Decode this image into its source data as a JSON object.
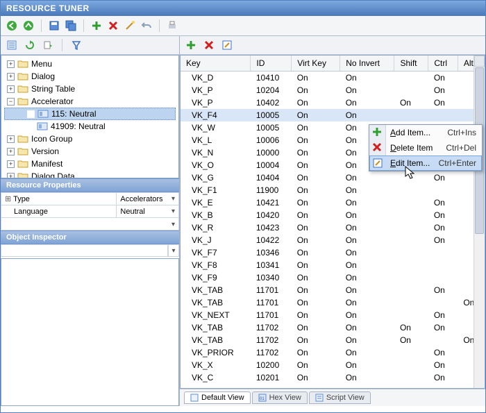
{
  "app": {
    "title": "RESOURCE TUNER"
  },
  "tree": {
    "items": [
      {
        "label": "Menu",
        "expander": "+",
        "depth": 1
      },
      {
        "label": "Dialog",
        "expander": "+",
        "depth": 1
      },
      {
        "label": "String Table",
        "expander": "+",
        "depth": 1
      },
      {
        "label": "Accelerator",
        "expander": "−",
        "depth": 1
      },
      {
        "label": "115: Neutral",
        "expander": "",
        "depth": 2,
        "icon": "accel",
        "sel": true
      },
      {
        "label": "41909: Neutral",
        "expander": "",
        "depth": 2,
        "icon": "accel"
      },
      {
        "label": "Icon Group",
        "expander": "+",
        "depth": 1
      },
      {
        "label": "Version",
        "expander": "+",
        "depth": 1
      },
      {
        "label": "Manifest",
        "expander": "+",
        "depth": 1
      },
      {
        "label": "Dialog Data",
        "expander": "+",
        "depth": 1
      }
    ]
  },
  "panels": {
    "resprops": {
      "title": "Resource Properties",
      "rows": [
        {
          "name": "Type",
          "value": "Accelerators"
        },
        {
          "name": "Language",
          "value": "Neutral"
        }
      ]
    },
    "inspector": {
      "title": "Object Inspector"
    }
  },
  "grid": {
    "columns": [
      "Key",
      "ID",
      "Virt Key",
      "No Invert",
      "Shift",
      "Ctrl",
      "Alt"
    ],
    "rows": [
      {
        "key": "VK_D",
        "id": "10410",
        "virt": "On",
        "noinv": "On",
        "shift": "",
        "ctrl": "On",
        "alt": ""
      },
      {
        "key": "VK_P",
        "id": "10204",
        "virt": "On",
        "noinv": "On",
        "shift": "",
        "ctrl": "On",
        "alt": ""
      },
      {
        "key": "VK_P",
        "id": "10402",
        "virt": "On",
        "noinv": "On",
        "shift": "On",
        "ctrl": "On",
        "alt": ""
      },
      {
        "key": "VK_F4",
        "id": "10005",
        "virt": "On",
        "noinv": "On",
        "shift": "",
        "ctrl": "",
        "alt": "",
        "sel": true
      },
      {
        "key": "VK_W",
        "id": "10005",
        "virt": "On",
        "noinv": "On",
        "shift": "",
        "ctrl": "On",
        "alt": ""
      },
      {
        "key": "VK_L",
        "id": "10006",
        "virt": "On",
        "noinv": "On",
        "shift": "",
        "ctrl": "On",
        "alt": ""
      },
      {
        "key": "VK_N",
        "id": "10000",
        "virt": "On",
        "noinv": "On",
        "shift": "",
        "ctrl": "On",
        "alt": ""
      },
      {
        "key": "VK_O",
        "id": "10004",
        "virt": "On",
        "noinv": "On",
        "shift": "",
        "ctrl": "On",
        "alt": ""
      },
      {
        "key": "VK_G",
        "id": "10404",
        "virt": "On",
        "noinv": "On",
        "shift": "",
        "ctrl": "On",
        "alt": ""
      },
      {
        "key": "VK_F1",
        "id": "11900",
        "virt": "On",
        "noinv": "On",
        "shift": "",
        "ctrl": "",
        "alt": ""
      },
      {
        "key": "VK_E",
        "id": "10421",
        "virt": "On",
        "noinv": "On",
        "shift": "",
        "ctrl": "On",
        "alt": ""
      },
      {
        "key": "VK_B",
        "id": "10420",
        "virt": "On",
        "noinv": "On",
        "shift": "",
        "ctrl": "On",
        "alt": ""
      },
      {
        "key": "VK_R",
        "id": "10423",
        "virt": "On",
        "noinv": "On",
        "shift": "",
        "ctrl": "On",
        "alt": ""
      },
      {
        "key": "VK_J",
        "id": "10422",
        "virt": "On",
        "noinv": "On",
        "shift": "",
        "ctrl": "On",
        "alt": ""
      },
      {
        "key": "VK_F7",
        "id": "10346",
        "virt": "On",
        "noinv": "On",
        "shift": "",
        "ctrl": "",
        "alt": ""
      },
      {
        "key": "VK_F8",
        "id": "10341",
        "virt": "On",
        "noinv": "On",
        "shift": "",
        "ctrl": "",
        "alt": ""
      },
      {
        "key": "VK_F9",
        "id": "10340",
        "virt": "On",
        "noinv": "On",
        "shift": "",
        "ctrl": "",
        "alt": ""
      },
      {
        "key": "VK_TAB",
        "id": "11701",
        "virt": "On",
        "noinv": "On",
        "shift": "",
        "ctrl": "On",
        "alt": ""
      },
      {
        "key": "VK_TAB",
        "id": "11701",
        "virt": "On",
        "noinv": "On",
        "shift": "",
        "ctrl": "",
        "alt": "On"
      },
      {
        "key": "VK_NEXT",
        "id": "11701",
        "virt": "On",
        "noinv": "On",
        "shift": "",
        "ctrl": "On",
        "alt": ""
      },
      {
        "key": "VK_TAB",
        "id": "11702",
        "virt": "On",
        "noinv": "On",
        "shift": "On",
        "ctrl": "On",
        "alt": ""
      },
      {
        "key": "VK_TAB",
        "id": "11702",
        "virt": "On",
        "noinv": "On",
        "shift": "On",
        "ctrl": "",
        "alt": "On"
      },
      {
        "key": "VK_PRIOR",
        "id": "11702",
        "virt": "On",
        "noinv": "On",
        "shift": "",
        "ctrl": "On",
        "alt": ""
      },
      {
        "key": "VK_X",
        "id": "10200",
        "virt": "On",
        "noinv": "On",
        "shift": "",
        "ctrl": "On",
        "alt": ""
      },
      {
        "key": "VK_C",
        "id": "10201",
        "virt": "On",
        "noinv": "On",
        "shift": "",
        "ctrl": "On",
        "alt": ""
      }
    ]
  },
  "contextmenu": {
    "items": [
      {
        "label_pre": "",
        "underline": "A",
        "label_post": "dd Item...",
        "shortcut": "Ctrl+Ins"
      },
      {
        "label_pre": "",
        "underline": "D",
        "label_post": "elete Item",
        "shortcut": "Ctrl+Del"
      },
      {
        "label_pre": "",
        "underline": "E",
        "label_post": "dit Item...",
        "shortcut": "Ctrl+Enter",
        "hover": true
      }
    ]
  },
  "tabs": {
    "items": [
      {
        "label": "Default View",
        "active": true
      },
      {
        "label": "Hex View"
      },
      {
        "label": "Script View"
      }
    ]
  }
}
